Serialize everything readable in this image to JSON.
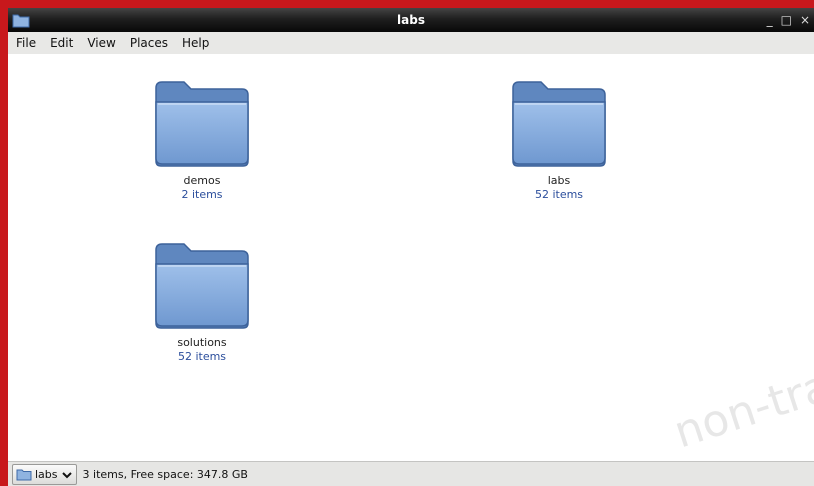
{
  "window": {
    "title": "labs",
    "controls": {
      "minimize": "_",
      "maximize": "□",
      "close": "×"
    }
  },
  "menubar": {
    "items": [
      {
        "label": "File"
      },
      {
        "label": "Edit"
      },
      {
        "label": "View"
      },
      {
        "label": "Places"
      },
      {
        "label": "Help"
      }
    ]
  },
  "folders": [
    {
      "name": "demos",
      "count": "2 items",
      "icon": "folder-icon"
    },
    {
      "name": "labs",
      "count": "52 items",
      "icon": "folder-icon"
    },
    {
      "name": "solutions",
      "count": "52 items",
      "icon": "folder-icon"
    }
  ],
  "statusbar": {
    "location": "labs",
    "status": "3 items, Free space: 347.8 GB"
  },
  "watermark": "non-tran",
  "colors": {
    "titlebar": "#1f1f1f",
    "folder_blue": "#7aa2d6",
    "item_count": "#2b4e9c",
    "frame": "#c8181c"
  }
}
